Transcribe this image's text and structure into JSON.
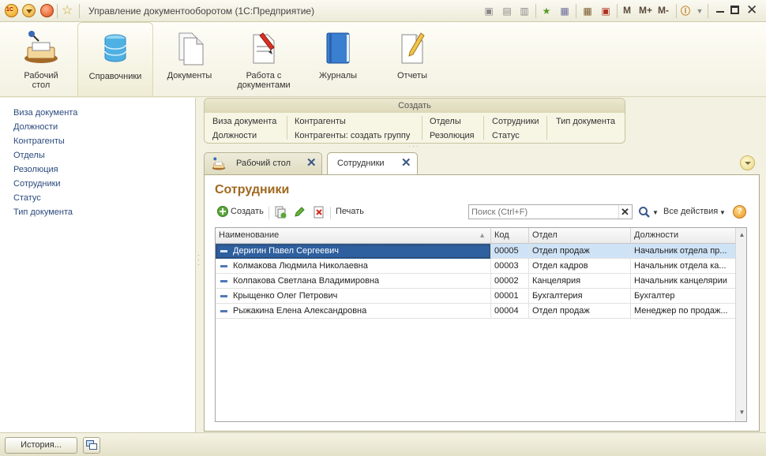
{
  "window": {
    "title": "Управление документооборотом  (1С:Предприятие)",
    "logo_text": "1С",
    "toolbar_text_buttons": [
      "M",
      "M+",
      "M-"
    ]
  },
  "sections": [
    {
      "label": "Рабочий\nстол",
      "icon": "desktop-icon",
      "active": false
    },
    {
      "label": "Справочники",
      "icon": "database-icon",
      "active": true
    },
    {
      "label": "Документы",
      "icon": "documents-icon",
      "active": false
    },
    {
      "label": "Работа с\nдокументами",
      "icon": "document-work-icon",
      "active": false
    },
    {
      "label": "Журналы",
      "icon": "journal-book-icon",
      "active": false
    },
    {
      "label": "Отчеты",
      "icon": "report-pencil-icon",
      "active": false
    }
  ],
  "nav": {
    "items": [
      "Виза документа",
      "Должности",
      "Контрагенты",
      "Отделы",
      "Резолюция",
      "Сотрудники",
      "Статус",
      "Тип документа"
    ]
  },
  "create": {
    "header": "Создать",
    "columns": [
      [
        "Виза документа",
        "Должности"
      ],
      [
        "Контрагенты",
        "Контрагенты: создать группу"
      ],
      [
        "Отделы",
        "Резолюция"
      ],
      [
        "Сотрудники",
        "Статус"
      ],
      [
        "Тип документа"
      ]
    ]
  },
  "tabs": [
    {
      "label": "Рабочий стол",
      "active": false
    },
    {
      "label": "Сотрудники",
      "active": true
    }
  ],
  "form": {
    "title": "Сотрудники",
    "create_label": "Создать",
    "print_label": "Печать",
    "search_placeholder": "Поиск (Ctrl+F)",
    "all_actions_label": "Все действия",
    "help_label": "?"
  },
  "table": {
    "columns": [
      "Наименование",
      "Код",
      "Отдел",
      "Должности"
    ],
    "rows": [
      {
        "name": "Деригин Павел Сергеевич",
        "code": "00005",
        "dept": "Отдел продаж",
        "position": "Начальник отдела пр...",
        "selected": true
      },
      {
        "name": "Колмакова Людмила Николаевна",
        "code": "00003",
        "dept": "Отдел кадров",
        "position": "Начальник отдела ка...",
        "selected": false
      },
      {
        "name": "Колпакова Светлана Владимировна",
        "code": "00002",
        "dept": "Канцелярия",
        "position": "Начальник канцелярии",
        "selected": false
      },
      {
        "name": "Крыщенко Олег Петрович",
        "code": "00001",
        "dept": "Бухгалтерия",
        "position": "Бухгалтер",
        "selected": false
      },
      {
        "name": "Рыжакина Елена Александровна",
        "code": "00004",
        "dept": "Отдел продаж",
        "position": "Менеджер по продаж...",
        "selected": false
      }
    ]
  },
  "bottom": {
    "history_label": "История..."
  }
}
